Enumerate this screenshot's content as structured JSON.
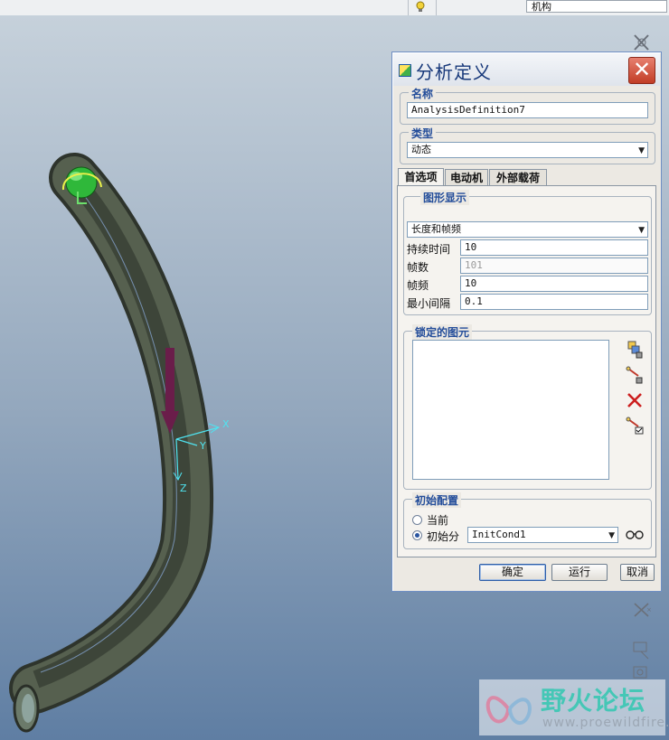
{
  "top_bar": {
    "mode_value": "机构"
  },
  "dialog": {
    "title": "分析定义",
    "close_glyph": "✕",
    "name_group": {
      "label": "名称",
      "value": "AnalysisDefinition7"
    },
    "type_group": {
      "label": "类型",
      "selected": "动态"
    },
    "tabs": [
      {
        "label": "首选项",
        "active": true
      },
      {
        "label": "电动机",
        "active": false
      },
      {
        "label": "外部载荷",
        "active": false
      }
    ],
    "graphic_display": {
      "label": "图形显示",
      "mode_selected": "长度和帧频",
      "fields": [
        {
          "label": "持续时间",
          "value": "10",
          "disabled": false
        },
        {
          "label": "帧数",
          "value": "101",
          "disabled": true
        },
        {
          "label": "帧频",
          "value": "10",
          "disabled": false
        },
        {
          "label": "最小间隔",
          "value": "0.1",
          "disabled": false
        }
      ]
    },
    "locked_entities": {
      "label": "锁定的图元",
      "icons": [
        "lock-body-icon",
        "lock-connection-icon",
        "delete-icon",
        "lock-check-icon"
      ]
    },
    "initial_config": {
      "label": "初始配置",
      "options": [
        {
          "label": "当前",
          "checked": false
        },
        {
          "label": "初始分",
          "checked": true
        }
      ],
      "condition_selected": "InitCond1"
    },
    "buttons": {
      "ok": "确定",
      "run": "运行",
      "cancel": "取消"
    }
  },
  "viewport": {
    "axis_labels": {
      "x": "X",
      "y": "Y",
      "z": "Z"
    }
  },
  "watermark": {
    "site_name": "野火论坛",
    "url": "www.proewildfire.cn"
  },
  "colors": {
    "pipe": "#4d5548",
    "ball": "#2fb83a",
    "arrow": "#6a1d4a",
    "axis": "#4fe3f0",
    "title_text": "#17387a",
    "group_label": "#234d9a"
  }
}
